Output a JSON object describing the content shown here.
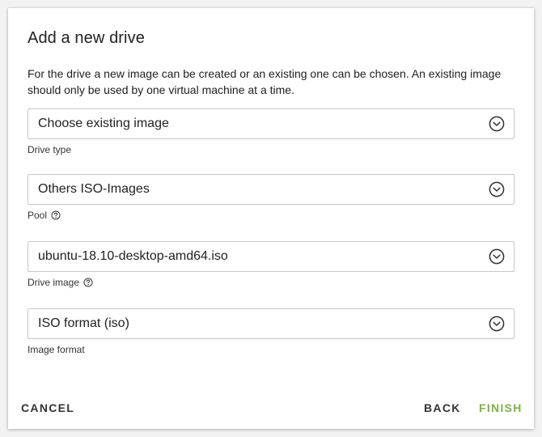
{
  "dialog": {
    "title": "Add a new drive",
    "description": "For the drive a new image can be created or an existing one can be chosen. An existing image should only be used by one virtual machine at a time."
  },
  "fields": [
    {
      "value": "Choose existing image",
      "label": "Drive type",
      "help": false
    },
    {
      "value": "Others ISO-Images",
      "label": "Pool",
      "help": true
    },
    {
      "value": "ubuntu-18.10-desktop-amd64.iso",
      "label": "Drive image",
      "help": true
    },
    {
      "value": "ISO format (iso)",
      "label": "Image format",
      "help": false
    }
  ],
  "icons": {
    "select_toggle": "chevron-down-circle-icon",
    "help": "question-circle-icon"
  },
  "footer": {
    "cancel_label": "CANCEL",
    "back_label": "BACK",
    "finish_label": "FINISH"
  },
  "colors": {
    "accent": "#7cb342",
    "text": "#212121",
    "border": "#c8c8c8"
  }
}
